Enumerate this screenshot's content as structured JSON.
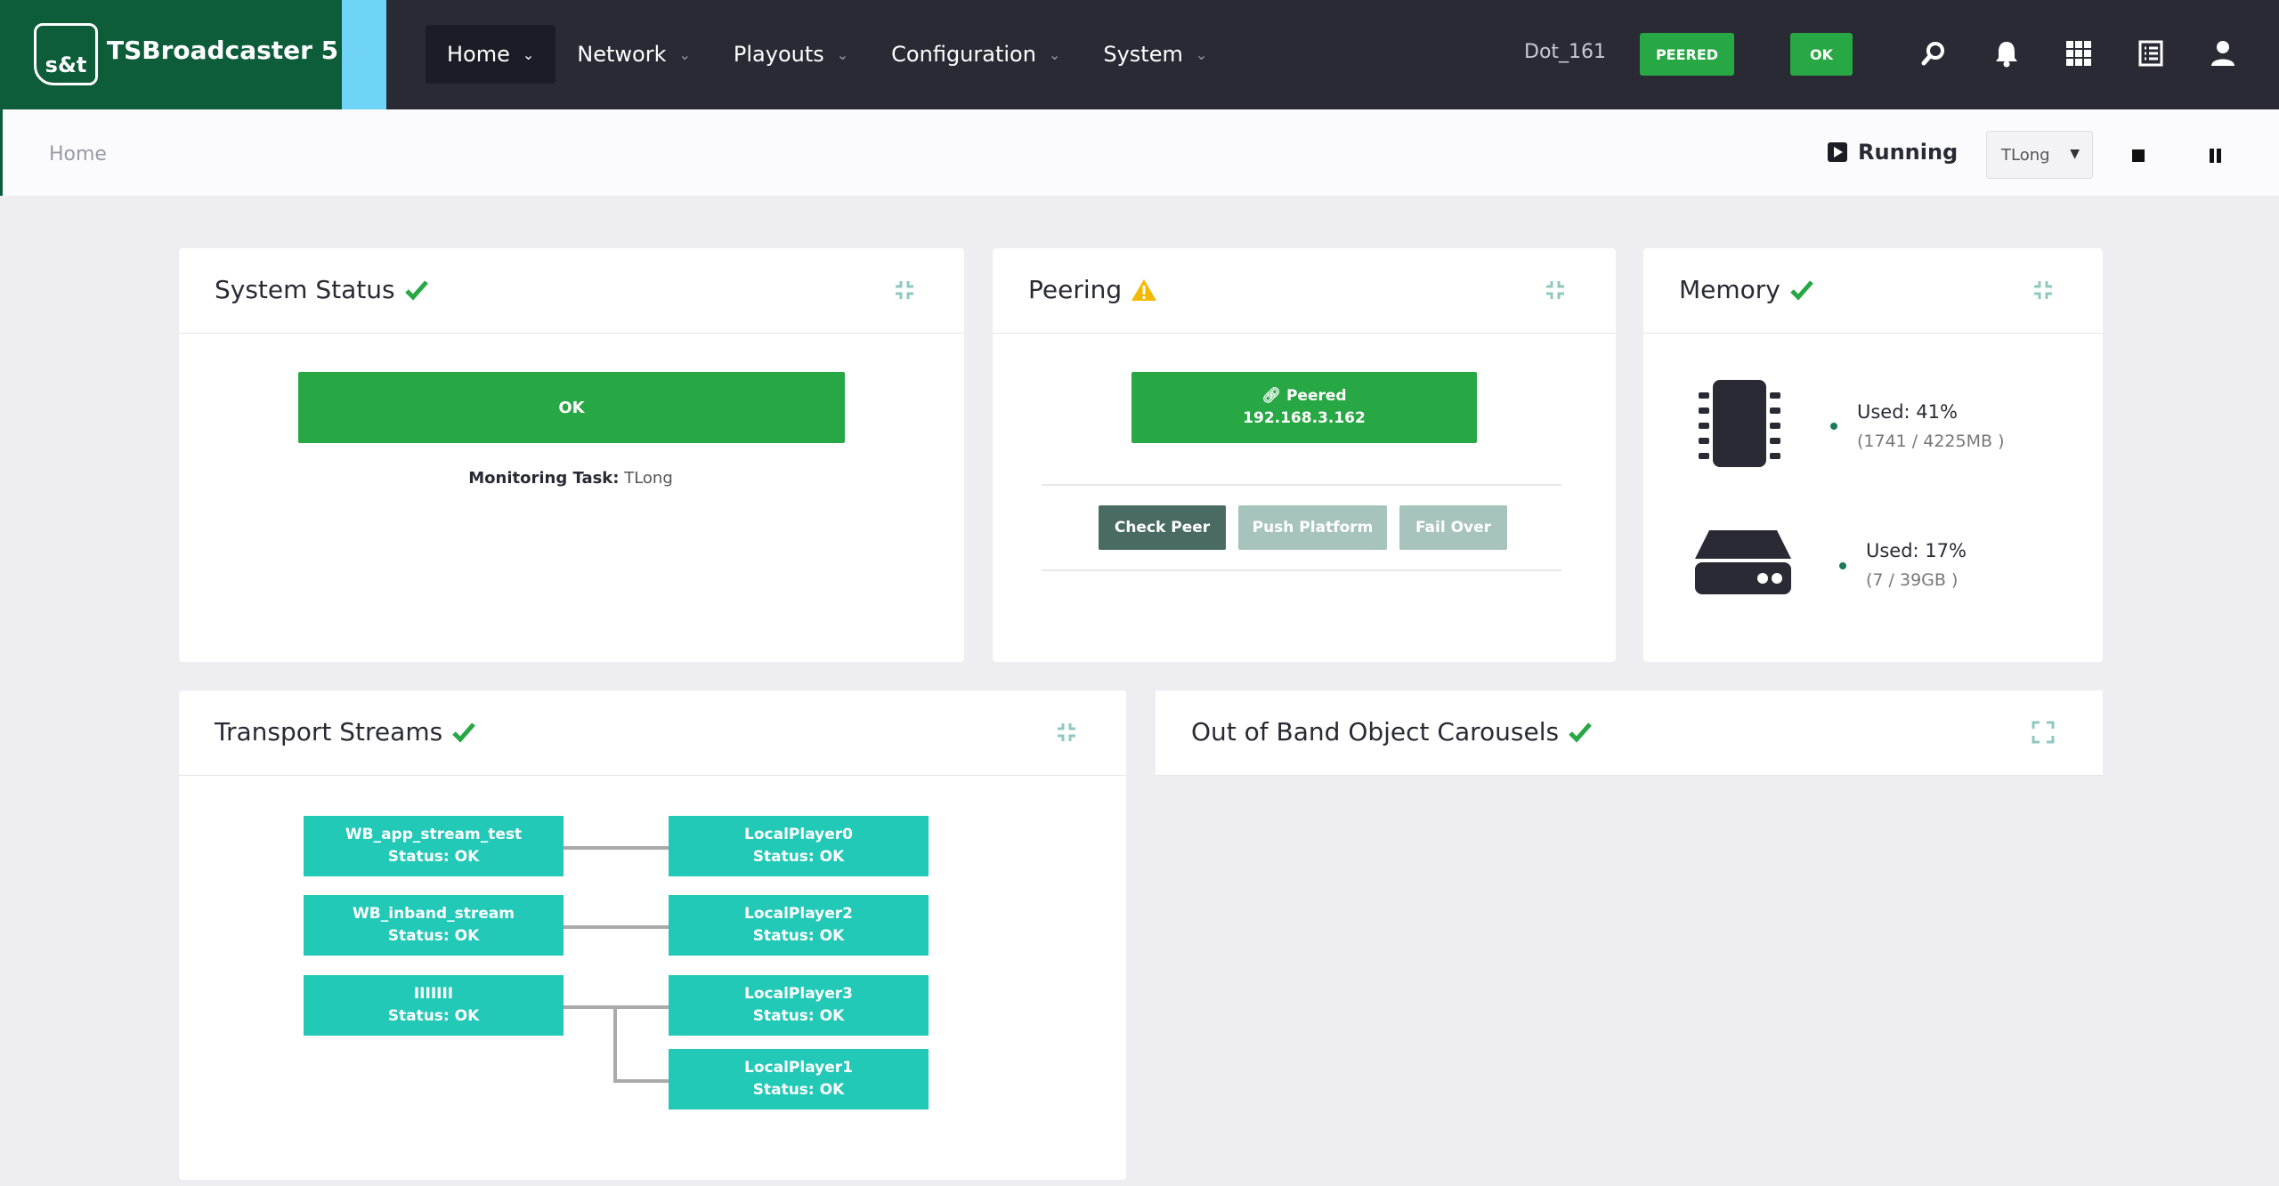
{
  "app": {
    "name": "TSBroadcaster 5",
    "logo_text": "s&t"
  },
  "nav": {
    "items": [
      {
        "label": "Home"
      },
      {
        "label": "Network"
      },
      {
        "label": "Playouts"
      },
      {
        "label": "Configuration"
      },
      {
        "label": "System"
      }
    ]
  },
  "header": {
    "hostname": "Dot_161",
    "peered_badge": "PEERED",
    "ok_badge": "OK"
  },
  "breadcrumb": {
    "current": "Home"
  },
  "control": {
    "state": "Running",
    "task": "TLong"
  },
  "system_status": {
    "title": "System Status",
    "status": "OK",
    "monitoring_label": "Monitoring Task:",
    "monitoring_value": "TLong"
  },
  "peering": {
    "title": "Peering",
    "status_label": "Peered",
    "address": "192.168.3.162",
    "buttons": {
      "check": "Check Peer",
      "push": "Push Platform",
      "failover": "Fail Over"
    }
  },
  "memory": {
    "title": "Memory",
    "ram": {
      "used": "Used: 41%",
      "detail": "(1741 / 4225MB )"
    },
    "disk": {
      "used": "Used: 17%",
      "detail": "(7 / 39GB )"
    }
  },
  "transport_streams": {
    "title": "Transport Streams",
    "inputs": [
      {
        "name": "WB_app_stream_test",
        "status": "Status: OK"
      },
      {
        "name": "WB_inband_stream",
        "status": "Status: OK"
      },
      {
        "name": "IIIIIII",
        "status": "Status: OK"
      }
    ],
    "outputs": [
      {
        "name": "LocalPlayer0",
        "status": "Status: OK"
      },
      {
        "name": "LocalPlayer2",
        "status": "Status: OK"
      },
      {
        "name": "LocalPlayer3",
        "status": "Status: OK"
      },
      {
        "name": "LocalPlayer1",
        "status": "Status: OK"
      }
    ]
  },
  "carousels": {
    "title": "Out of Band Object Carousels"
  },
  "colors": {
    "green": "#28a745",
    "teal": "#22c9b7",
    "dark": "#2a2a35",
    "brand": "#0d5c3a",
    "accent": "#6ed3f7"
  }
}
